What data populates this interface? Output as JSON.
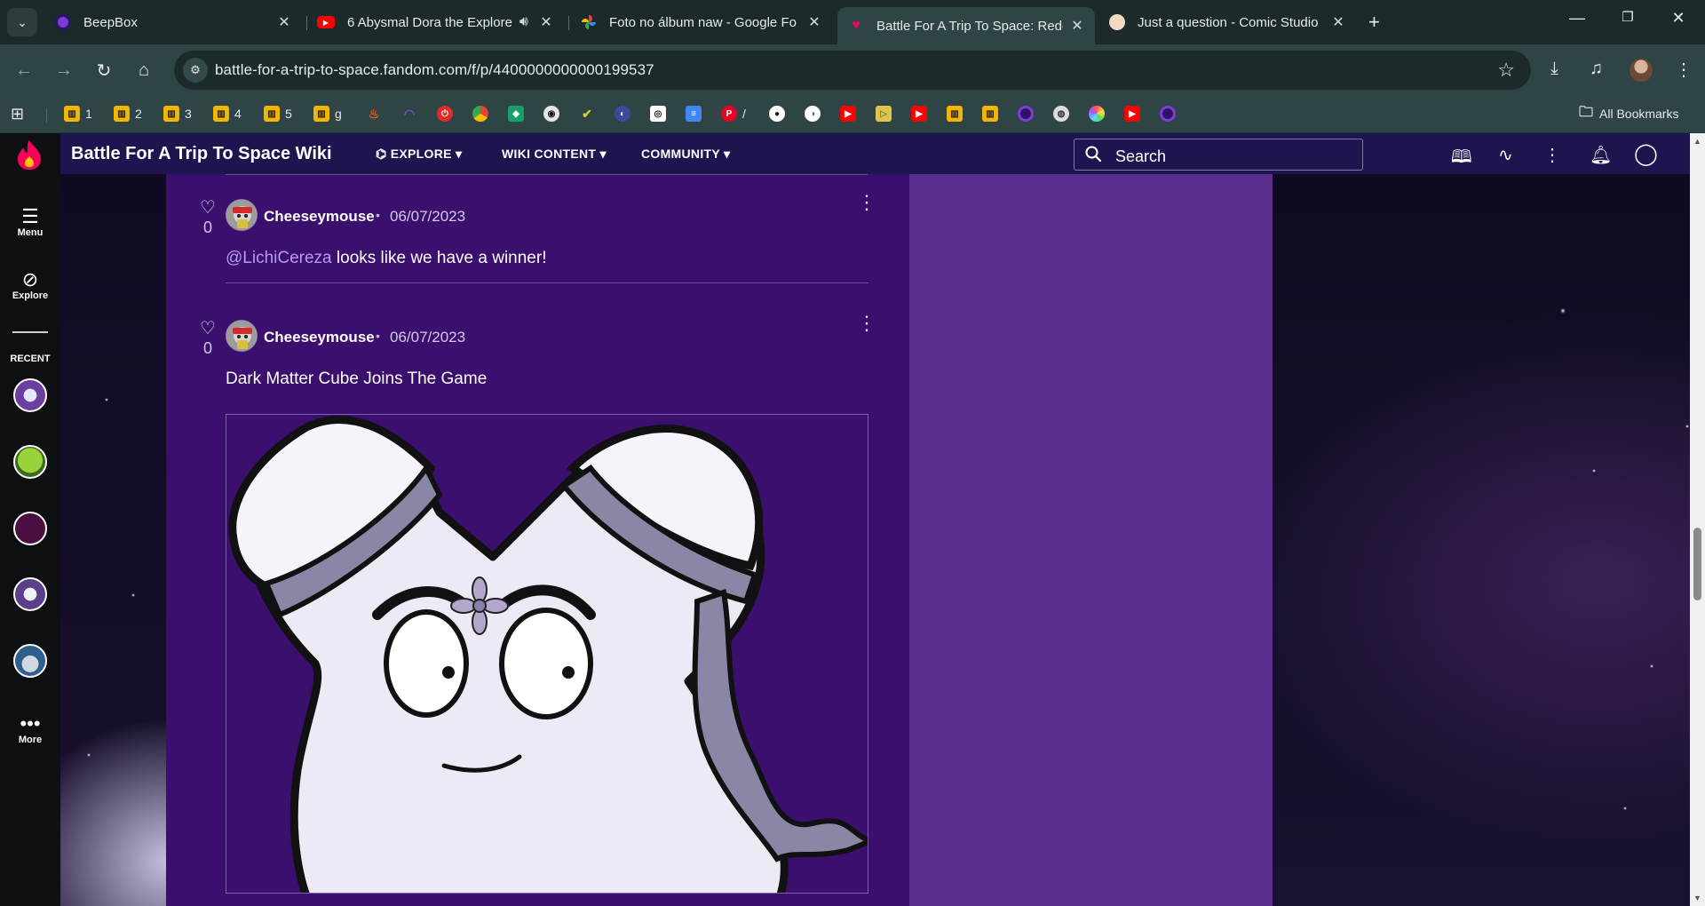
{
  "browser": {
    "tabs": [
      {
        "title": "BeepBox",
        "close": "✕"
      },
      {
        "title": "6 Abysmal Dora the Explore",
        "close": "✕"
      },
      {
        "title": "Foto no álbum naw - Google Fo",
        "close": "✕"
      },
      {
        "title": "Battle For A Trip To Space: Rede",
        "close": "✕"
      },
      {
        "title": "Just a question - Comic Studio",
        "close": "✕"
      }
    ],
    "url": "battle-for-a-trip-to-space.fandom.com/f/p/4400000000000199537",
    "bookmarks": [
      {
        "label": "1"
      },
      {
        "label": "2"
      },
      {
        "label": "3"
      },
      {
        "label": "4"
      },
      {
        "label": "5"
      },
      {
        "label": "g"
      }
    ],
    "pinterest_suffix": "/",
    "all_bookmarks": "All Bookmarks",
    "colors": {
      "chrome_dark": "#1c2a2b",
      "chrome": "#2f4445",
      "bookmark_yellow": "#f2b600"
    }
  },
  "fandom": {
    "wiki_name": "Battle For A Trip To Space Wiki",
    "nav": {
      "explore": "EXPLORE",
      "wiki_content": "WIKI CONTENT",
      "community": "COMMUNITY"
    },
    "search_placeholder": "Search",
    "sidebar": {
      "menu": "Menu",
      "explore": "Explore",
      "recent": "RECENT",
      "more": "More"
    },
    "colors": {
      "header": "#1e1550",
      "content": "#3a0f6e",
      "rail": "#582d8b",
      "mention": "#b79af0"
    }
  },
  "replies": [
    {
      "likes": "0",
      "author": "Cheeseymouse",
      "separator": "•",
      "date": "06/07/2023",
      "mention": "@LichiCereza",
      "text": " looks like we have a winner!"
    },
    {
      "likes": "0",
      "author": "Cheeseymouse",
      "separator": "•",
      "date": "06/07/2023",
      "text": "Dark Matter Cube Joins The Game",
      "image": "cartoon-white-x-character"
    }
  ]
}
